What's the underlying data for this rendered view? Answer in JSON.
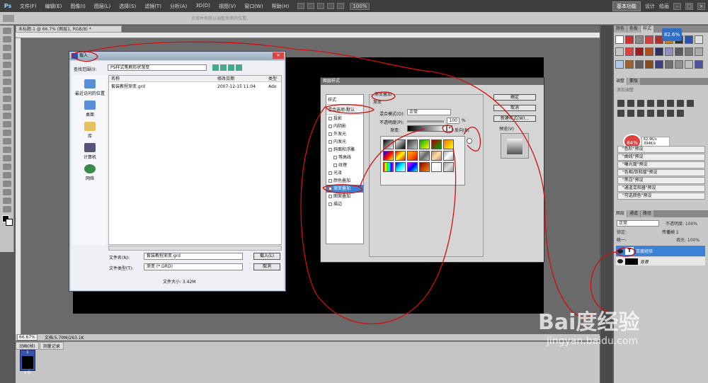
{
  "app": {
    "logo": "Ps",
    "menus": [
      "文件(F)",
      "编辑(E)",
      "图像(I)",
      "图层(L)",
      "选择(S)",
      "滤镜(T)",
      "分析(A)",
      "3D(D)",
      "视图(V)",
      "窗口(W)",
      "帮助(H)"
    ],
    "zoom_combo": "100%",
    "workspace_button": "基本功能",
    "workspace_links": [
      "设计",
      "绘画"
    ],
    "window_controls": [
      "–",
      "□",
      "×"
    ]
  },
  "options_bar": {
    "hint": "点按并拖移以调整渐变的位置。"
  },
  "document": {
    "tab": "未标题-1 @ 66.7% (图层1, RGB/8) *",
    "status_zoom": "66.67%",
    "status_doc": "文档:5.70M/263.1K"
  },
  "animation_panel": {
    "tabs": [
      "动画(帧)",
      "测量记录"
    ],
    "frame_number": "1",
    "frame_time": "0 秒"
  },
  "right_panels": {
    "swatch_tabs": [
      "颜色",
      "色板",
      "样式"
    ],
    "swatch_colors": [
      "#ffffff",
      "#d03030",
      "#888888",
      "#d04040",
      "#b03030",
      "#c08030",
      "#303030",
      "#3050b0",
      "#e0e0e0",
      "#c8c8c8",
      "#e04040",
      "#9a2020",
      "#b05020",
      "#303060",
      "#9090c0",
      "#5a5a5a",
      "#7a7a7a",
      "#aaaaaa",
      "#b0c8e8",
      "#a06030",
      "#606060",
      "#8a4a20",
      "#404080",
      "#707070",
      "#909090",
      "#c0c0c0",
      "#5050a0"
    ],
    "blue_badge": "82.6%",
    "adjust_tabs": [
      "调整",
      "蒙版"
    ],
    "adjust_title": "添加调整",
    "cpu_badge": "84%",
    "cpu_stats": [
      "62.9K/s",
      "394K/s"
    ],
    "presets": [
      "\"色阶\"预设",
      "\"曲线\"预设",
      "\"曝光度\"预设",
      "\"色相/饱和度\"预设",
      "\"黑白\"预设",
      "\"通道混和器\"预设",
      "\"可选颜色\"预设"
    ],
    "layers_tabs": [
      "图层",
      "通道",
      "路径"
    ],
    "blend_mode": "正常",
    "opacity_label": "不透明度: 100%",
    "unify_label": "统一:",
    "propagate": "传播帧 1",
    "lock_label": "锁定:",
    "fill_label": "填充: 100%",
    "layers": [
      {
        "name": "百度经验",
        "type": "T"
      },
      {
        "name": "背景"
      }
    ]
  },
  "file_dialog": {
    "title": "载入",
    "look_in_label": "查找范围(I):",
    "look_in_value": "PS样式笔刷形状渐变",
    "places": [
      "最近访问的位置",
      "桌面",
      "库",
      "计算机",
      "网络"
    ],
    "columns": [
      "名称",
      "修改日期",
      "类型"
    ],
    "files": [
      {
        "name": "套装教程渐变.grd",
        "date": "2007-12-15 11:04",
        "type": "Ado"
      }
    ],
    "filename_label": "文件名(N):",
    "filename_value": "套装教程渐变.grd",
    "filetype_label": "文件类型(T):",
    "filetype_value": "渐变 (*.GRD)",
    "load_button": "载入(L)",
    "cancel_button": "取消",
    "file_size": "文件大小: 3.42M"
  },
  "style_dialog": {
    "title": "图层样式",
    "styles_header": "样式",
    "blend_default": "混合选项:默认",
    "items": [
      {
        "label": "投影",
        "sub": false,
        "selected": false
      },
      {
        "label": "内阴影",
        "sub": false,
        "selected": false
      },
      {
        "label": "外发光",
        "sub": false,
        "selected": false
      },
      {
        "label": "内发光",
        "sub": false,
        "selected": false
      },
      {
        "label": "斜面和浮雕",
        "sub": false,
        "selected": false
      },
      {
        "label": "等高线",
        "sub": true,
        "selected": false
      },
      {
        "label": "纹理",
        "sub": true,
        "selected": false
      },
      {
        "label": "光泽",
        "sub": false,
        "selected": false
      },
      {
        "label": "颜色叠加",
        "sub": false,
        "selected": false
      },
      {
        "label": "渐变叠加",
        "sub": false,
        "selected": true
      },
      {
        "label": "图案叠加",
        "sub": false,
        "selected": false
      },
      {
        "label": "描边",
        "sub": false,
        "selected": false
      }
    ],
    "group_title": "渐变叠加",
    "group_sub": "渐变",
    "blend_label": "混合模式(O):",
    "blend_value": "正常",
    "opacity_label": "不透明度(P):",
    "opacity_value": "100",
    "opacity_unit": "%",
    "gradient_label": "渐变:",
    "reverse_label": "反向(R)",
    "ok_button": "确定",
    "cancel_button": "取消",
    "new_style_button": "新建样式(W)...",
    "preview_label": "预览(V)",
    "gradient_swatches": [
      "linear-gradient(135deg,#000,#fff)",
      "linear-gradient(135deg,#fff,#000)",
      "linear-gradient(135deg,#333,#ccc)",
      "linear-gradient(135deg,#0a0,#ff0)",
      "linear-gradient(135deg,#a00,#0a0)",
      "linear-gradient(135deg,#e70,#ff0)",
      "linear-gradient(135deg,#00f,#f00,#ff0)",
      "linear-gradient(135deg,#f00,#ff0,#f00)",
      "linear-gradient(135deg,#fa0,#f60,#d00)",
      "linear-gradient(135deg,#ccc,#666,#ccc)",
      "linear-gradient(135deg,#b87,#fda,#b87)",
      "linear-gradient(135deg,#aaa,#fff,#aaa)",
      "linear-gradient(90deg,#f00,#ff0,#0f0,#0ff,#00f,#f0f)",
      "linear-gradient(135deg,#00f,#0ff,#fff)",
      "linear-gradient(135deg,#f0f,#00f,#0ff)",
      "linear-gradient(135deg,#800,#f80)",
      "linear-gradient(135deg,#fff,#eee)",
      "linear-gradient(135deg,#999,#ddd,#999)"
    ]
  },
  "watermark": {
    "logo": "Bai度经验",
    "url": "jingyan.baidu.com"
  }
}
